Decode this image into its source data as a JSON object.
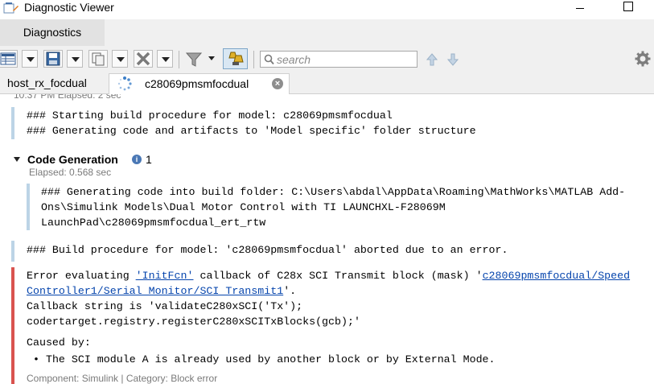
{
  "window": {
    "title": "Diagnostic Viewer"
  },
  "top_tab": {
    "label": "Diagnostics"
  },
  "toolbar": {
    "search_placeholder": "search"
  },
  "file_tabs": [
    {
      "label": "host_rx_focdual"
    },
    {
      "label": "c28069pmsmfocdual",
      "close_glyph": "×"
    }
  ],
  "log": {
    "top_meta": "10:37 PM   Elapsed: 2 sec",
    "start_lines": "### Starting build procedure for model: c28069pmsmfocdual\n### Generating code and artifacts to 'Model specific' folder structure",
    "code_generation": {
      "title": "Code Generation",
      "info_count": "1",
      "elapsed": "Elapsed: 0.568 sec",
      "text": "### Generating code into build folder: C:\\Users\\abdal\\AppData\\Roaming\\MathWorks\\MATLAB Add-\nOns\\Simulink Models\\Dual Motor Control with TI LAUNCHXL-F28069M\nLaunchPad\\c28069pmsmfocdual_ert_rtw"
    },
    "aborted": "### Build procedure for model: 'c28069pmsmfocdual' aborted due to an error.",
    "error": {
      "prefix": "Error evaluating ",
      "callback_link": "'InitFcn'",
      "middle": " callback of C28x SCI Transmit block (mask) '",
      "block_link_1": "c28069pmsmfocdual/Speed",
      "block_link_2": "Controller1/Serial Monitor/SCI Transmit1",
      "after_link": "'.",
      "callback_line_1": "Callback string is 'validateC280xSCI('Tx');",
      "callback_line_2": "codertarget.registry.registerC280xSCITxBlocks(gcb);'",
      "caused_by": "Caused by:",
      "cause": "• The SCI module A is already used by another block or by External Mode.",
      "footer": "Component:  Simulink | Category:  Block error"
    }
  },
  "colors": {
    "link": "#0645ad",
    "error_bar": "#d9534f",
    "info_bar": "#bcd4e6"
  }
}
